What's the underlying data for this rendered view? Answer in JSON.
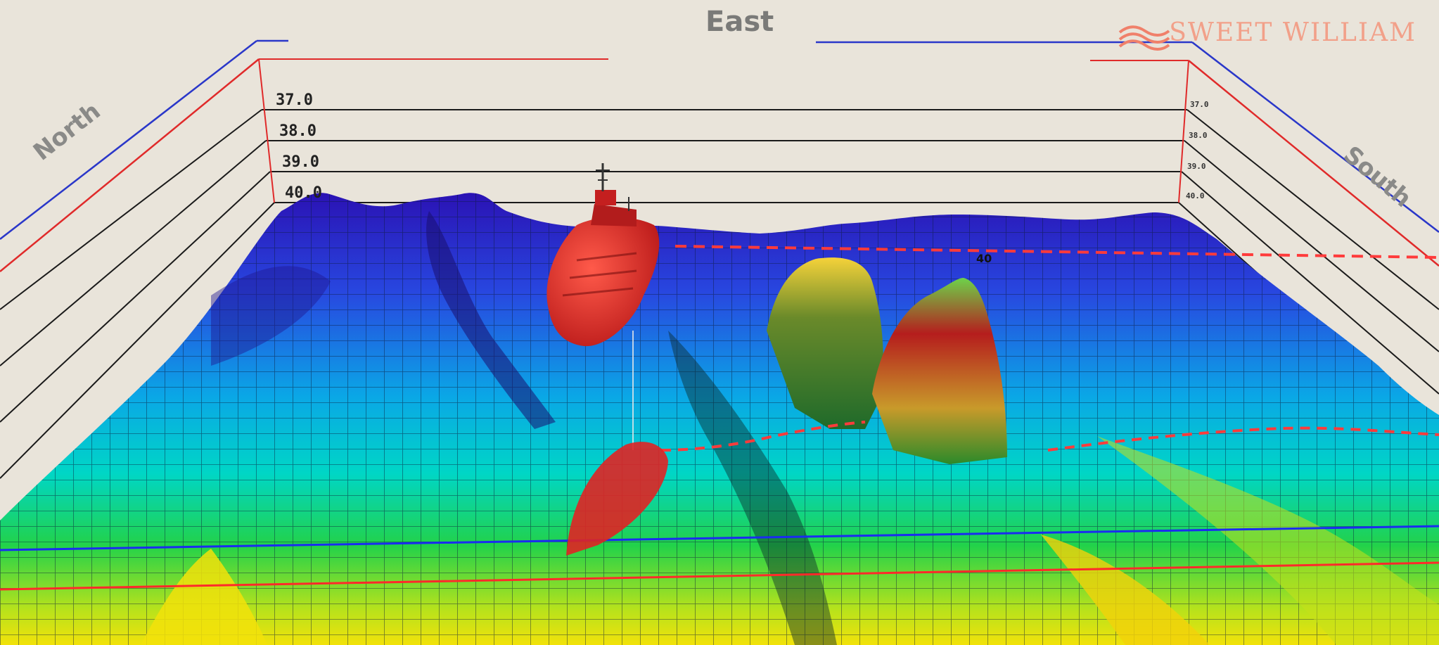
{
  "axes": {
    "east_label": "East",
    "north_label": "North",
    "south_label": "South"
  },
  "depth_scale": {
    "left": [
      "37.0",
      "38.0",
      "39.0",
      "40.0"
    ],
    "right": [
      "37.0",
      "38.0",
      "39.0",
      "40.0"
    ]
  },
  "contour_label": "40",
  "brand": {
    "text": "SWEET WILLIAM",
    "logo_color": "#f0806a"
  },
  "colors": {
    "background": "#e9e4da",
    "blue_axis": "#2a37c9",
    "red_axis": "#e02a2a",
    "vessel": "#d82a2a",
    "terrain_deep": "#2f1bb8",
    "terrain_mid": "#00c4e8",
    "terrain_shallow": "#f0e000"
  },
  "icons": {
    "vessel": "ship-model-icon",
    "sonar_cone": "sonar-cone-icon",
    "brand": "wave-logo-icon"
  }
}
